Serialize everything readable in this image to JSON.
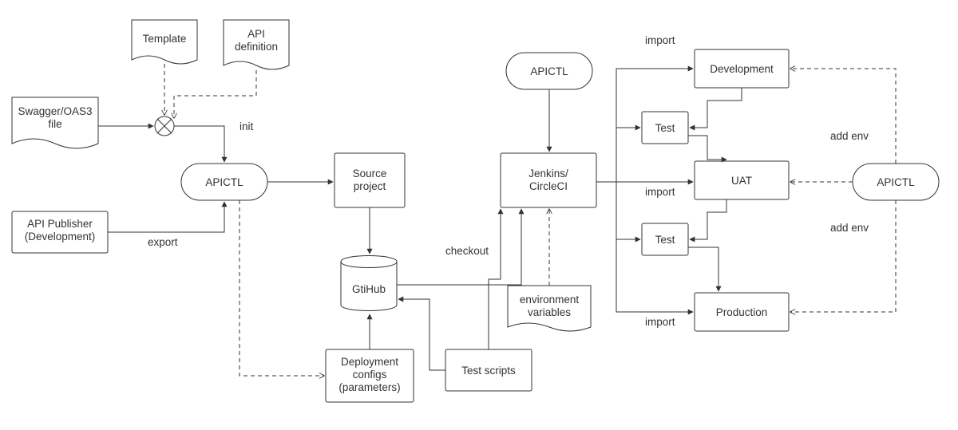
{
  "nodes": {
    "template": "Template",
    "api_definition": "API\ndefinition",
    "swagger": "Swagger/OAS3\nfile",
    "api_publisher": "API Publisher\n(Development)",
    "apictl_left": "APICTL",
    "apictl_top": "APICTL",
    "apictl_right": "APICTL",
    "source_project": "Source\nproject",
    "jenkins": "Jenkins/\nCircleCI",
    "github": "GtiHub",
    "env_vars": "environment\nvariables",
    "deploy_configs": "Deployment\nconfigs\n(parameters)",
    "test_scripts": "Test scripts",
    "development": "Development",
    "uat": "UAT",
    "production": "Production",
    "test_top": "Test",
    "test_bottom": "Test"
  },
  "edges": {
    "init": "init",
    "export": "export",
    "checkout": "checkout",
    "import_dev": "import",
    "import_uat": "import",
    "import_prod": "import",
    "add_env_top": "add env",
    "add_env_bottom": "add env"
  }
}
